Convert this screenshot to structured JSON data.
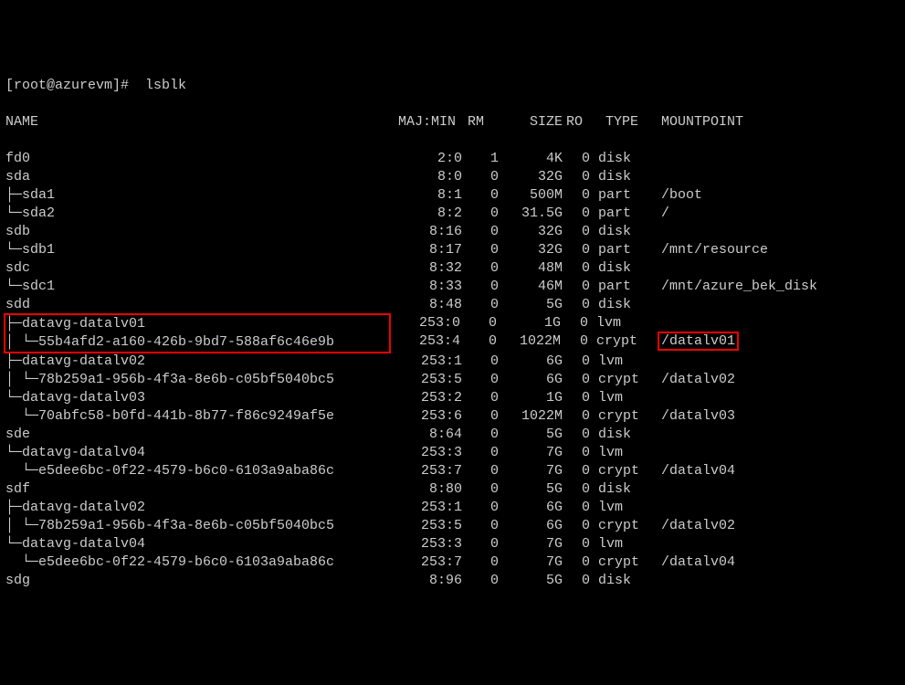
{
  "prompt": "[root@azurevm]#  lsblk",
  "columns": {
    "name": "NAME",
    "majmin": "MAJ:MIN",
    "rm": "RM",
    "size": "SIZE",
    "ro": "RO",
    "type": "TYPE",
    "mount": "MOUNTPOINT"
  },
  "rows": [
    {
      "name": "fd0",
      "majmin": "2:0",
      "rm": "1",
      "size": "4K",
      "ro": "0",
      "type": "disk",
      "mount": "",
      "indent": 0
    },
    {
      "name": "sda",
      "majmin": "8:0",
      "rm": "0",
      "size": "32G",
      "ro": "0",
      "type": "disk",
      "mount": "",
      "indent": 0
    },
    {
      "name": "├─sda1",
      "majmin": "8:1",
      "rm": "0",
      "size": "500M",
      "ro": "0",
      "type": "part",
      "mount": "/boot",
      "indent": 0
    },
    {
      "name": "└─sda2",
      "majmin": "8:2",
      "rm": "0",
      "size": "31.5G",
      "ro": "0",
      "type": "part",
      "mount": "/",
      "indent": 0
    },
    {
      "name": "sdb",
      "majmin": "8:16",
      "rm": "0",
      "size": "32G",
      "ro": "0",
      "type": "disk",
      "mount": "",
      "indent": 0
    },
    {
      "name": "└─sdb1",
      "majmin": "8:17",
      "rm": "0",
      "size": "32G",
      "ro": "0",
      "type": "part",
      "mount": "/mnt/resource",
      "indent": 0
    },
    {
      "name": "sdc",
      "majmin": "8:32",
      "rm": "0",
      "size": "48M",
      "ro": "0",
      "type": "disk",
      "mount": "",
      "indent": 0
    },
    {
      "name": "└─sdc1",
      "majmin": "8:33",
      "rm": "0",
      "size": "46M",
      "ro": "0",
      "type": "part",
      "mount": "/mnt/azure_bek_disk",
      "indent": 0
    },
    {
      "name": "sdd",
      "majmin": "8:48",
      "rm": "0",
      "size": "5G",
      "ro": "0",
      "type": "disk",
      "mount": "",
      "indent": 0
    },
    {
      "name": "├─datavg-datalv01",
      "majmin": "253:0",
      "rm": "0",
      "size": "1G",
      "ro": "0",
      "type": "lvm",
      "mount": "",
      "indent": 0,
      "hl_left": true
    },
    {
      "name": "│ └─55b4afd2-a160-426b-9bd7-588af6c46e9b",
      "majmin": "253:4",
      "rm": "0",
      "size": "1022M",
      "ro": "0",
      "type": "crypt",
      "mount": "/datalv01",
      "indent": 0,
      "hl_left": true,
      "hl_mount": true
    },
    {
      "name": "├─datavg-datalv02",
      "majmin": "253:1",
      "rm": "0",
      "size": "6G",
      "ro": "0",
      "type": "lvm",
      "mount": "",
      "indent": 0
    },
    {
      "name": "│ └─78b259a1-956b-4f3a-8e6b-c05bf5040bc5",
      "majmin": "253:5",
      "rm": "0",
      "size": "6G",
      "ro": "0",
      "type": "crypt",
      "mount": "/datalv02",
      "indent": 0
    },
    {
      "name": "└─datavg-datalv03",
      "majmin": "253:2",
      "rm": "0",
      "size": "1G",
      "ro": "0",
      "type": "lvm",
      "mount": "",
      "indent": 0
    },
    {
      "name": "  └─70abfc58-b0fd-441b-8b77-f86c9249af5e",
      "majmin": "253:6",
      "rm": "0",
      "size": "1022M",
      "ro": "0",
      "type": "crypt",
      "mount": "/datalv03",
      "indent": 0
    },
    {
      "name": "sde",
      "majmin": "8:64",
      "rm": "0",
      "size": "5G",
      "ro": "0",
      "type": "disk",
      "mount": "",
      "indent": 0
    },
    {
      "name": "└─datavg-datalv04",
      "majmin": "253:3",
      "rm": "0",
      "size": "7G",
      "ro": "0",
      "type": "lvm",
      "mount": "",
      "indent": 0
    },
    {
      "name": "  └─e5dee6bc-0f22-4579-b6c0-6103a9aba86c",
      "majmin": "253:7",
      "rm": "0",
      "size": "7G",
      "ro": "0",
      "type": "crypt",
      "mount": "/datalv04",
      "indent": 0
    },
    {
      "name": "sdf",
      "majmin": "8:80",
      "rm": "0",
      "size": "5G",
      "ro": "0",
      "type": "disk",
      "mount": "",
      "indent": 0
    },
    {
      "name": "├─datavg-datalv02",
      "majmin": "253:1",
      "rm": "0",
      "size": "6G",
      "ro": "0",
      "type": "lvm",
      "mount": "",
      "indent": 0
    },
    {
      "name": "│ └─78b259a1-956b-4f3a-8e6b-c05bf5040bc5",
      "majmin": "253:5",
      "rm": "0",
      "size": "6G",
      "ro": "0",
      "type": "crypt",
      "mount": "/datalv02",
      "indent": 0
    },
    {
      "name": "└─datavg-datalv04",
      "majmin": "253:3",
      "rm": "0",
      "size": "7G",
      "ro": "0",
      "type": "lvm",
      "mount": "",
      "indent": 0
    },
    {
      "name": "  └─e5dee6bc-0f22-4579-b6c0-6103a9aba86c",
      "majmin": "253:7",
      "rm": "0",
      "size": "7G",
      "ro": "0",
      "type": "crypt",
      "mount": "/datalv04",
      "indent": 0
    },
    {
      "name": "sdg",
      "majmin": "8:96",
      "rm": "0",
      "size": "5G",
      "ro": "0",
      "type": "disk",
      "mount": "",
      "indent": 0
    }
  ]
}
